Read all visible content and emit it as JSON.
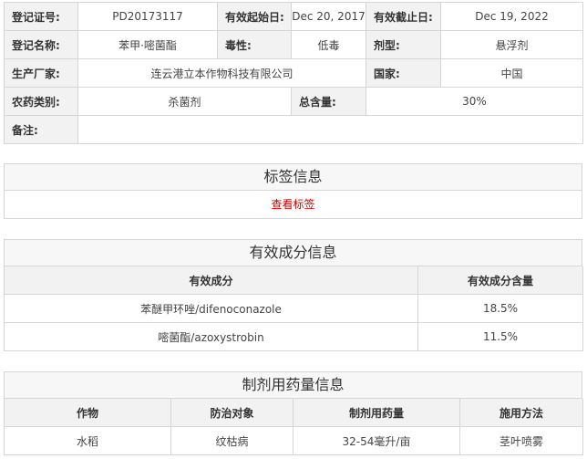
{
  "info": {
    "reg_no_label": "登记证号:",
    "reg_no": "PD20173117",
    "valid_from_label": "有效起始日:",
    "valid_from": "Dec 20, 2017",
    "valid_to_label": "有效截止日:",
    "valid_to": "Dec 19, 2022",
    "name_label": "登记名称:",
    "name": "苯甲·嘧菌酯",
    "toxicity_label": "毒性:",
    "toxicity": "低毒",
    "formulation_label": "剂型:",
    "formulation": "悬浮剂",
    "manufacturer_label": "生产厂家:",
    "manufacturer": "连云港立本作物科技有限公司",
    "country_label": "国家:",
    "country": "中国",
    "category_label": "农药类别:",
    "category": "杀菌剂",
    "total_content_label": "总含量:",
    "total_content": "30%",
    "memo_label": "备注:",
    "memo": ""
  },
  "label_section": {
    "title": "标签信息",
    "view_link": "查看标签"
  },
  "ingredient_section": {
    "title": "有效成分信息",
    "headers": [
      "有效成分",
      "有效成分含量"
    ],
    "rows": [
      [
        "苯醚甲环唑/difenoconazole",
        "18.5%"
      ],
      [
        "嘧菌酯/azoxystrobin",
        "11.5%"
      ]
    ]
  },
  "usage_section": {
    "title": "制剂用药量信息",
    "headers": [
      "作物",
      "防治对象",
      "制剂用药量",
      "施用方法"
    ],
    "rows": [
      [
        "水稻",
        "纹枯病",
        "32-54毫升/亩",
        "茎叶喷雾"
      ]
    ]
  }
}
